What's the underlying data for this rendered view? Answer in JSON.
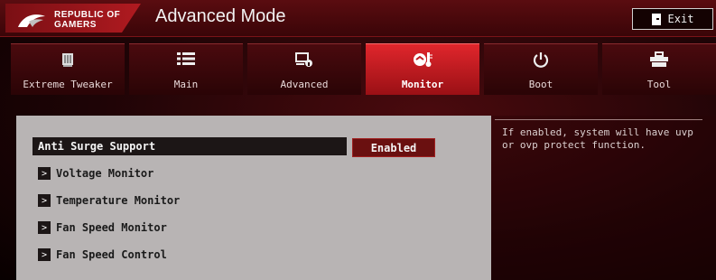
{
  "brand": {
    "line1": "REPUBLIC OF",
    "line2": "GAMERS"
  },
  "header": {
    "title": "Advanced Mode",
    "exit_label": "Exit"
  },
  "tabs": [
    {
      "label": "Extreme Tweaker",
      "icon": "chip-icon"
    },
    {
      "label": "Main",
      "icon": "list-icon"
    },
    {
      "label": "Advanced",
      "icon": "advanced-settings-icon"
    },
    {
      "label": "Monitor",
      "icon": "thermometer-icon",
      "active": true
    },
    {
      "label": "Boot",
      "icon": "power-icon"
    },
    {
      "label": "Tool",
      "icon": "toolbox-icon"
    }
  ],
  "settings": {
    "anti_surge": {
      "label": "Anti Surge Support",
      "value": "Enabled"
    },
    "submenus": [
      "Voltage Monitor",
      "Temperature Monitor",
      "Fan Speed Monitor",
      "Fan Speed Control"
    ]
  },
  "help": {
    "text": "If enabled, system will have uvp or ovp protect function."
  },
  "colors": {
    "accent": "#e0262c",
    "background": "#1e0406",
    "panel": "#b8b4b4"
  }
}
